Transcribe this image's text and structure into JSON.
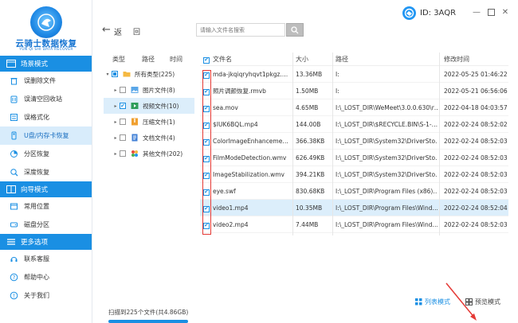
{
  "app": {
    "title": "云骑士数据恢复",
    "subtitle": "YUN QI SHI DATA RECOVER"
  },
  "sidebar": {
    "sections": [
      {
        "header": "场景模式",
        "items": [
          {
            "label": "误删除文件",
            "icon": "trash-icon",
            "active": false
          },
          {
            "label": "误清空回收站",
            "icon": "recycle-bin-icon",
            "active": false
          },
          {
            "label": "误格式化",
            "icon": "format-icon",
            "active": false
          },
          {
            "label": "U盘/内存卡恢复",
            "icon": "usb-icon",
            "active": true
          },
          {
            "label": "分区恢复",
            "icon": "partition-icon",
            "active": false
          },
          {
            "label": "深度恢复",
            "icon": "deep-scan-icon",
            "active": false
          }
        ]
      },
      {
        "header": "向导模式",
        "items": [
          {
            "label": "常用位置",
            "icon": "location-icon",
            "active": false
          },
          {
            "label": "磁盘分区",
            "icon": "disk-icon",
            "active": false
          }
        ]
      },
      {
        "header": "更多选项",
        "items": [
          {
            "label": "联系客服",
            "icon": "headset-icon",
            "active": false
          },
          {
            "label": "帮助中心",
            "icon": "help-icon",
            "active": false
          },
          {
            "label": "关于我们",
            "icon": "info-icon",
            "active": false
          }
        ]
      }
    ]
  },
  "topbar": {
    "back_label": "返",
    "home_label": "回",
    "search_placeholder": "请输入文件名搜索",
    "user_id": "ID: 3AQR"
  },
  "categories": {
    "headers": [
      "类型",
      "路径",
      "时间"
    ],
    "items": [
      {
        "label": "所有类型(225)",
        "icon": "folder-icon",
        "expander": "▾",
        "check": "partial",
        "selected": false,
        "indent": 0
      },
      {
        "label": "图片文件(8)",
        "icon": "image-icon",
        "expander": "▸",
        "check": "none",
        "selected": false,
        "indent": 1
      },
      {
        "label": "视频文件(10)",
        "icon": "video-icon",
        "expander": "▸",
        "check": "checked",
        "selected": true,
        "indent": 1
      },
      {
        "label": "压缩文件(1)",
        "icon": "archive-icon",
        "expander": "▸",
        "check": "none",
        "selected": false,
        "indent": 1
      },
      {
        "label": "文档文件(4)",
        "icon": "document-icon",
        "expander": "▸",
        "check": "none",
        "selected": false,
        "indent": 1
      },
      {
        "label": "其他文件(202)",
        "icon": "other-files-icon",
        "expander": "▸",
        "check": "none",
        "selected": false,
        "indent": 1
      }
    ]
  },
  "files": {
    "headers": {
      "name": "文件名",
      "size": "大小",
      "path": "路径",
      "modified": "修改时间"
    },
    "rows": [
      {
        "name": "mda-jkqiqryhqvt1pkgz.…",
        "size": "13.36MB",
        "path": "I:",
        "modified": "2022-05-25 01:46:22"
      },
      {
        "name": "照片调颜恢复.rmvb",
        "size": "1.50MB",
        "path": "I:",
        "modified": "2022-05-21 06:56:06"
      },
      {
        "name": "sea.mov",
        "size": "4.65MB",
        "path": "I:\\_LOST_DIR\\WeMeet\\3.0.0.630\\r…",
        "modified": "2022-04-18 04:03:57"
      },
      {
        "name": "$IUK6BQL.mp4",
        "size": "144.00B",
        "path": "I:\\_LOST_DIR\\$RECYCLE.BIN\\S-1-…",
        "modified": "2022-02-24 08:52:02"
      },
      {
        "name": "ColorImageEnhanceme…",
        "size": "366.38KB",
        "path": "I:\\_LOST_DIR\\System32\\DriverSto…",
        "modified": "2022-02-24 08:52:03"
      },
      {
        "name": "FilmModeDetection.wmv",
        "size": "626.49KB",
        "path": "I:\\_LOST_DIR\\System32\\DriverSto…",
        "modified": "2022-02-24 08:52:03"
      },
      {
        "name": "ImageStabilization.wmv",
        "size": "394.21KB",
        "path": "I:\\_LOST_DIR\\System32\\DriverSto…",
        "modified": "2022-02-24 08:52:03"
      },
      {
        "name": "eye.swf",
        "size": "830.68KB",
        "path": "I:\\_LOST_DIR\\Program Files (x86)…",
        "modified": "2022-02-24 08:52:03"
      },
      {
        "name": "video1.mp4",
        "size": "10.35MB",
        "path": "I:\\_LOST_DIR\\Program Files\\Wind…",
        "modified": "2022-02-24 08:52:04",
        "selected": true
      },
      {
        "name": "video2.mp4",
        "size": "7.44MB",
        "path": "I:\\_LOST_DIR\\Program Files\\Wind…",
        "modified": "2022-02-24 08:52:03"
      }
    ]
  },
  "status": {
    "scan_result": "扫描到225个文件(共4.86GB)",
    "list_mode": "列表模式",
    "preview_mode": "预览模式"
  },
  "colors": {
    "accent": "#1a8fe3",
    "selected_row": "#dceefb",
    "annotation": "#e53935"
  }
}
